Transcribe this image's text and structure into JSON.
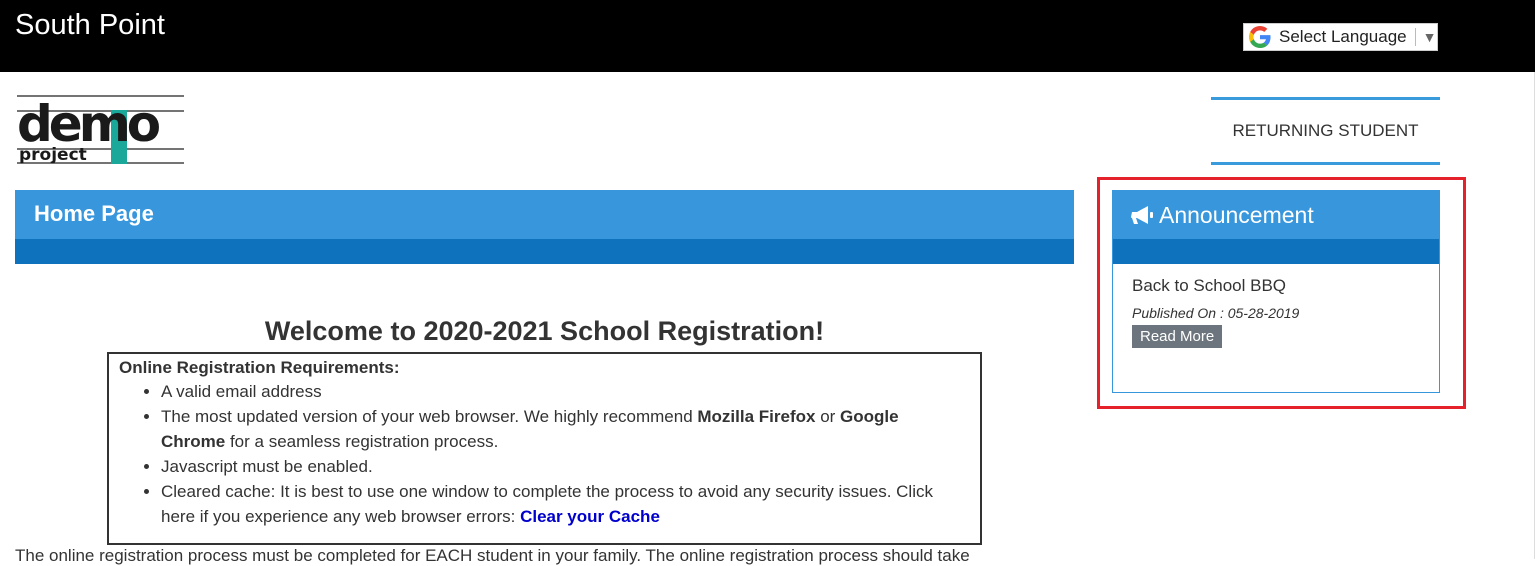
{
  "header": {
    "site_title": "South Point",
    "language_selector": {
      "label": "Select Language",
      "arrow": "▼",
      "icon": "google-g-icon"
    }
  },
  "logo": {
    "text_top": "demo",
    "text_bottom": "project"
  },
  "nav": {
    "returning_student": "RETURNING STUDENT"
  },
  "home": {
    "title": "Home Page"
  },
  "main": {
    "welcome": "Welcome to 2020-2021 School Registration!",
    "requirements_title": "Online Registration Requirements:",
    "requirements": {
      "item1": "A valid email address",
      "item2_a": "The most updated version of your web browser. We highly recommend ",
      "item2_firefox": "Mozilla Firefox",
      "item2_or": " or ",
      "item2_chrome": "Google Chrome",
      "item2_b": " for a seamless registration process.",
      "item3": "Javascript must be enabled.",
      "item4_a": "Cleared cache: It is best to use one window to complete the process to avoid any security issues. Click here if you experience any web browser errors: ",
      "item4_link": "Clear your Cache"
    },
    "bottom_text": "The online registration process must be completed for EACH student in your family. The online registration process should take"
  },
  "announcement": {
    "title": "Announcement",
    "icon": "megaphone-icon",
    "item_title": "Back to School BBQ",
    "published": "Published On : 05-28-2019",
    "read_more": "Read More"
  },
  "colors": {
    "header_bg": "#000000",
    "panel_header": "#3796dc",
    "panel_band": "#0e72bd",
    "highlight": "#e5222b",
    "link": "#0000cc",
    "button_bg": "#6c757d"
  }
}
